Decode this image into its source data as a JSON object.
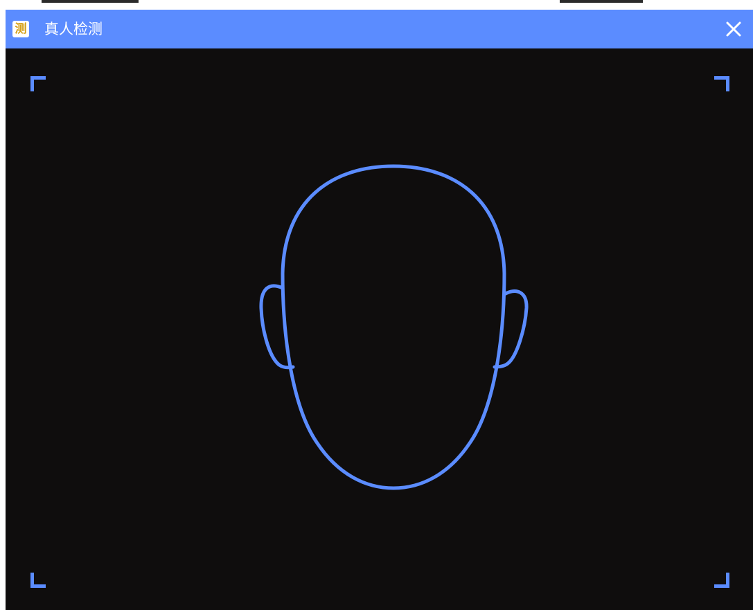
{
  "window": {
    "title": "真人检测",
    "app_icon_glyph": "测",
    "close_glyph": "✕"
  },
  "colors": {
    "titlebar": "#5b8cff",
    "accent": "#5b8cff",
    "camera_background": "#0f0d0d",
    "title_text": "#ffffff"
  },
  "icons": {
    "app": "detection-app-icon",
    "close": "close-icon",
    "face_outline": "face-outline-guide",
    "corners": [
      "corner-top-left",
      "corner-top-right",
      "corner-bottom-left",
      "corner-bottom-right"
    ]
  }
}
